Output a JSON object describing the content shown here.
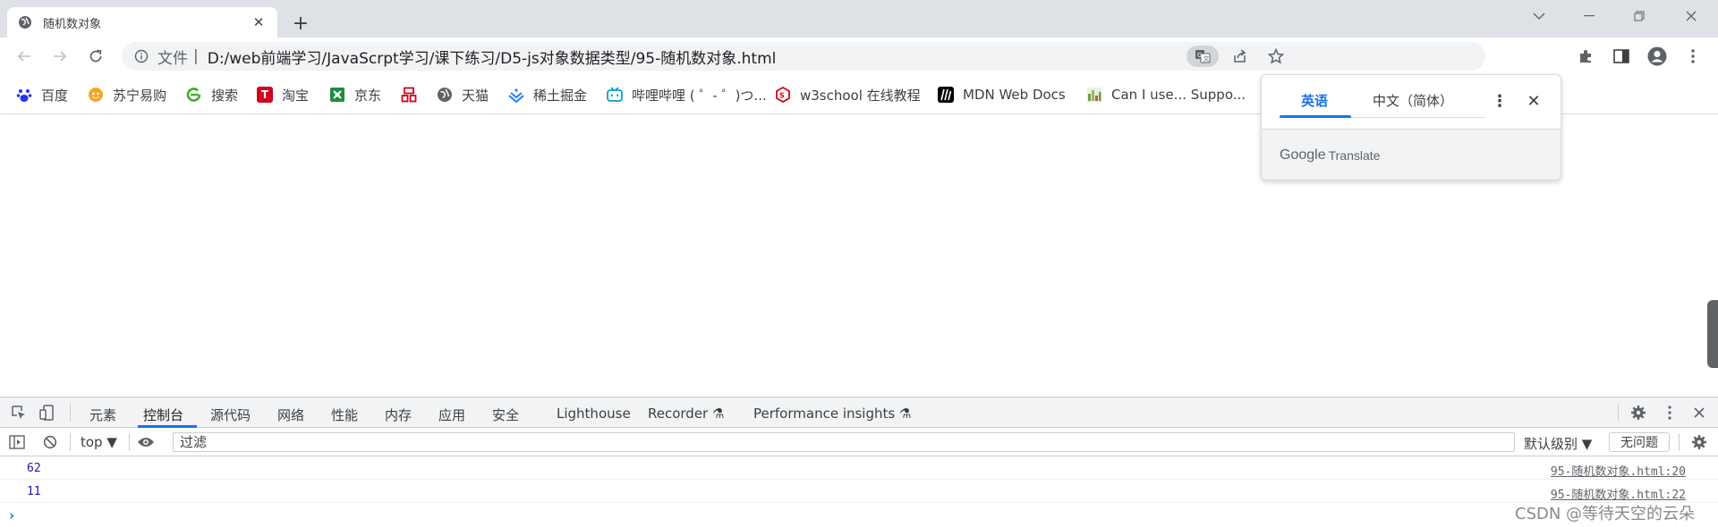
{
  "tab": {
    "title": "随机数对象",
    "close_label": "✕",
    "new_tab_label": "+"
  },
  "window": {
    "search_tabs_icon": "chevron-down-icon",
    "minimize_icon": "minimize-icon",
    "restore_icon": "restore-icon",
    "close_icon": "close-icon"
  },
  "omnibox": {
    "scheme_label": "文件",
    "separator": "|",
    "url": "D:/web前端学习/JavaScrpt学习/课下练习/D5-js对象数据类型/95-随机数对象.html"
  },
  "bookmarks": [
    {
      "label": "百度",
      "icon": "baidu-paw-icon",
      "color": "#2932e1"
    },
    {
      "label": "苏宁易购",
      "icon": "suning-icon",
      "color": "#f5a623"
    },
    {
      "label": "搜索",
      "icon": "search-e-icon",
      "color": "#3fae29"
    },
    {
      "label": "淘宝",
      "icon": "taobao-icon",
      "color": "#d0021b"
    },
    {
      "label": "京东",
      "icon": "jd-icon",
      "color": "#1e8e3e"
    },
    {
      "label": "",
      "icon": "grid-icon",
      "color": "#d0021b"
    },
    {
      "label": "天猫",
      "icon": "globe-icon",
      "color": "#5f6368"
    },
    {
      "label": "稀土掘金",
      "icon": "juejin-icon",
      "color": "#1e80ff"
    },
    {
      "label": "哔哩哔哩 ( ゜- ゜)つ...",
      "icon": "bilibili-icon",
      "color": "#00a1d6"
    },
    {
      "label": "w3school 在线教程",
      "icon": "w3school-icon",
      "color": "#d0021b"
    },
    {
      "label": "MDN Web Docs",
      "icon": "mdn-icon",
      "color": "#000000"
    },
    {
      "label": "Can I use... Suppo...",
      "icon": "caniuse-icon",
      "color": "#7a9a3e"
    }
  ],
  "translate": {
    "tab_source": "英语",
    "tab_target": "中文（简体）",
    "more_label": "⋮",
    "close_label": "✕",
    "brand_google": "Google",
    "brand_translate": "Translate",
    "accent": "#1a73e8"
  },
  "devtools": {
    "tabs": [
      "元素",
      "控制台",
      "源代码",
      "网络",
      "性能",
      "内存",
      "应用",
      "安全",
      "Lighthouse",
      "Recorder ⚗",
      "Performance insights ⚗"
    ],
    "active_tab": "控制台",
    "context": "top ▼",
    "filter_placeholder": "过滤",
    "level": "默认级别 ▼",
    "issues": "无问题",
    "console": [
      {
        "value": "62",
        "source": "95-随机数对象.html:20"
      },
      {
        "value": "11",
        "source": "95-随机数对象.html:22"
      }
    ],
    "prompt": "›"
  },
  "watermark": "CSDN @等待天空的云朵"
}
